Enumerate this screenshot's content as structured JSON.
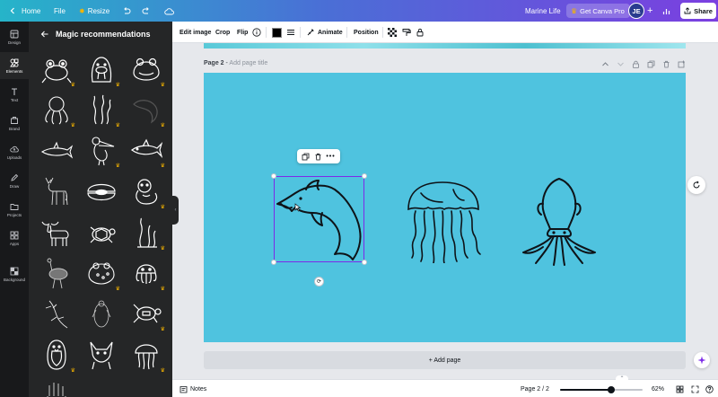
{
  "topbar": {
    "home_label": "Home",
    "file_label": "File",
    "resize_label": "Resize",
    "doc_title": "Marine Life",
    "get_pro_label": "Get Canva Pro",
    "avatar_initials": "JE",
    "share_label": "Share"
  },
  "rail": {
    "items": [
      {
        "label": "Design",
        "icon": "design-icon"
      },
      {
        "label": "Elements",
        "icon": "elements-icon"
      },
      {
        "label": "Text",
        "icon": "text-icon"
      },
      {
        "label": "Brand",
        "icon": "brand-icon"
      },
      {
        "label": "Uploads",
        "icon": "uploads-icon"
      },
      {
        "label": "Draw",
        "icon": "draw-icon"
      },
      {
        "label": "Projects",
        "icon": "projects-icon"
      },
      {
        "label": "Apps",
        "icon": "apps-icon"
      },
      {
        "label": "Background",
        "icon": "background-icon"
      }
    ]
  },
  "panel": {
    "title": "Magic recommendations",
    "elements": [
      {
        "icon": "frog-icon"
      },
      {
        "icon": "walrus-icon"
      },
      {
        "icon": "frog-outline-icon"
      },
      {
        "icon": "octopus-icon"
      },
      {
        "icon": "seaweed-icon"
      },
      {
        "icon": "dolphin-icon"
      },
      {
        "icon": "shark-icon"
      },
      {
        "icon": "pelican-icon"
      },
      {
        "icon": "shark-outline-icon"
      },
      {
        "icon": "deer-icon"
      },
      {
        "icon": "clam-icon"
      },
      {
        "icon": "otter-icon"
      },
      {
        "icon": "moose-icon"
      },
      {
        "icon": "turtle-icon"
      },
      {
        "icon": "kelp-icon"
      },
      {
        "icon": "ostrich-icon"
      },
      {
        "icon": "toad-icon"
      },
      {
        "icon": "octopus-cute-icon"
      },
      {
        "icon": "lizard-icon"
      },
      {
        "icon": "penguin-sketch-icon"
      },
      {
        "icon": "sea-turtle-icon"
      },
      {
        "icon": "penguin-icon"
      },
      {
        "icon": "fox-icon"
      },
      {
        "icon": "jellyfish-icon"
      }
    ]
  },
  "toolbar": {
    "edit_image_label": "Edit image",
    "crop_label": "Crop",
    "flip_label": "Flip",
    "animate_label": "Animate",
    "position_label": "Position",
    "color_swatch": "#000000"
  },
  "canvas": {
    "page_label_prefix": "Page 2",
    "page_label_sep": " - ",
    "page_title_placeholder": "Add page title",
    "page_background": "#4fc3df",
    "add_page_label": "+ Add page",
    "selection_color": "#7d2ae8"
  },
  "bottombar": {
    "notes_label": "Notes",
    "page_indicator": "Page 2 / 2",
    "zoom_label": "62%",
    "zoom_fraction": 0.62
  }
}
